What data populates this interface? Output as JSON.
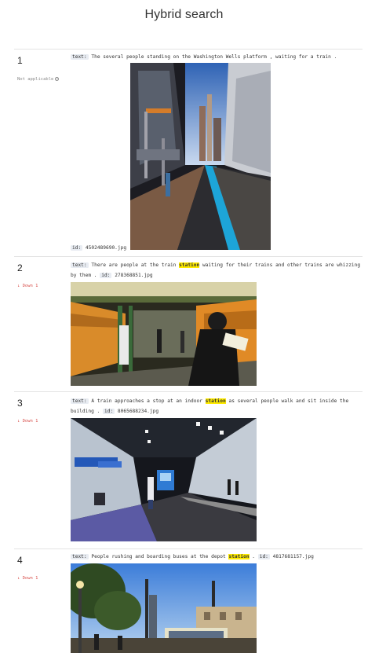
{
  "page": {
    "title": "Hybrid search"
  },
  "results": [
    {
      "rank": "1",
      "status": "Not applicable",
      "text_key": "text:",
      "text_before": "The several people standing on the Washington Wells platform , waiting for a train .",
      "highlight": "",
      "text_after": "",
      "id_key": "id:",
      "id_value": "4502489690.jpg"
    },
    {
      "rank": "2",
      "status": "Down 1",
      "text_key": "text:",
      "text_before": "There are people at the train ",
      "highlight": "station",
      "text_after": " waiting for their trains and other trains are whizzing by them .",
      "id_key": "id:",
      "id_value": "278368851.jpg"
    },
    {
      "rank": "3",
      "status": "Down 1",
      "text_key": "text:",
      "text_before": "A train approaches a stop at an indoor ",
      "highlight": "station",
      "text_after": " as several people walk and sit inside the building .",
      "id_key": "id:",
      "id_value": "8065688234.jpg"
    },
    {
      "rank": "4",
      "status": "Down 1",
      "text_key": "text:",
      "text_before": "People rushing and boarding buses at the depot ",
      "highlight": "station",
      "text_after": " .",
      "id_key": "id:",
      "id_value": "4817681157.jpg"
    }
  ],
  "icons": {
    "help": "help-circle-icon",
    "down": "arrow-down-icon"
  },
  "colors": {
    "highlight": "#ffeb00",
    "down": "#d9534f",
    "key_bg": "#e8ecf2",
    "divider": "#e3e3e3"
  }
}
